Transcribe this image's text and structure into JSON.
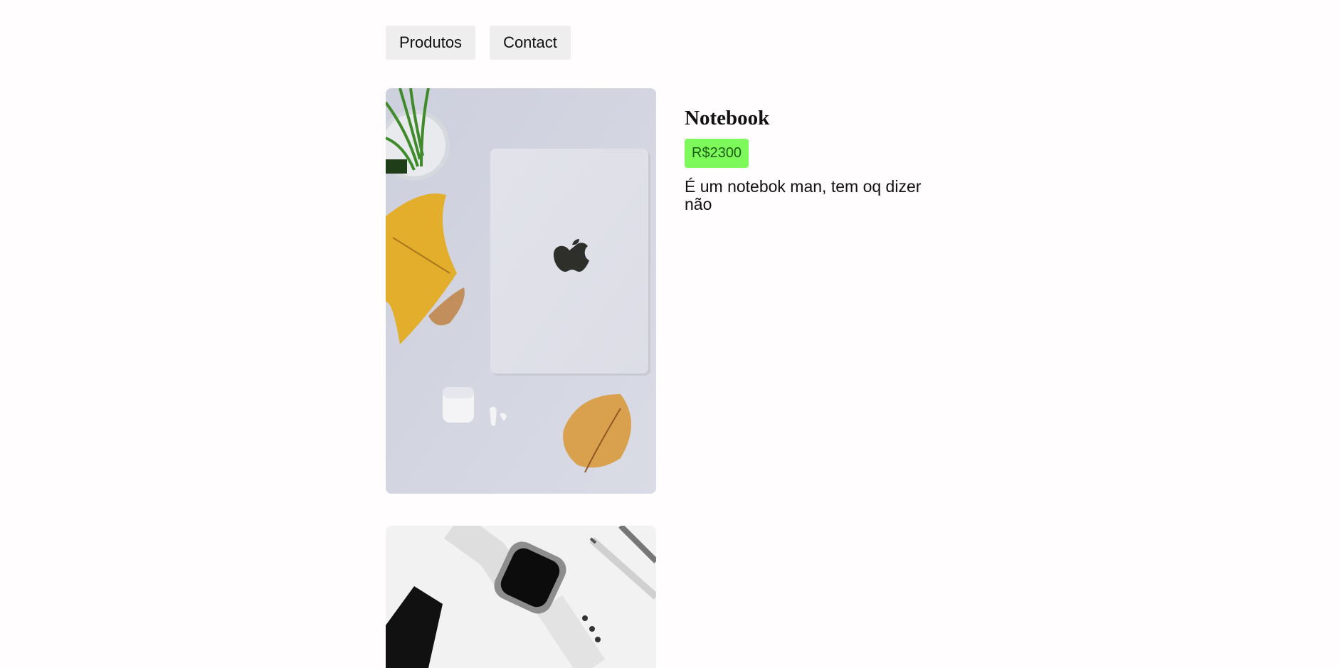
{
  "nav": {
    "items": [
      {
        "label": "Produtos"
      },
      {
        "label": "Contact"
      }
    ]
  },
  "products": [
    {
      "title": "Notebook",
      "price": "R$2300",
      "description": "É um notebok man, tem oq dizer não",
      "image": "laptop-on-desk-image"
    },
    {
      "image": "smartwatch-image"
    }
  ],
  "colors": {
    "price_badge_bg": "#7df95b",
    "price_badge_text": "#1c5d10",
    "nav_button_bg": "#eeeeee"
  }
}
